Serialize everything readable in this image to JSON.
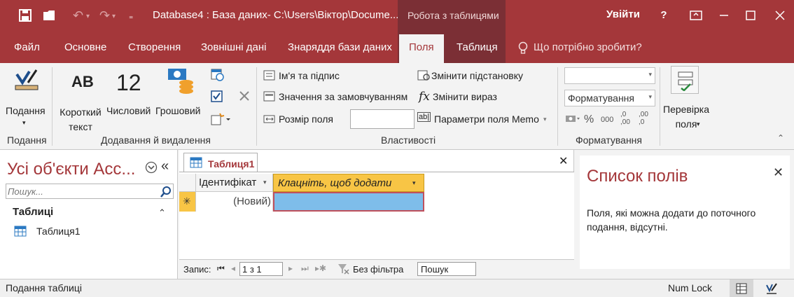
{
  "app": {
    "title": "Database4 : База даних- C:\\Users\\Віктор\\Docume...",
    "context_group": "Робота з таблицями",
    "signin": "Увійти",
    "help": "?"
  },
  "tabs": [
    "Файл",
    "Основне",
    "Створення",
    "Зовнішні дані",
    "Знаряддя бази даних",
    "Поля",
    "Таблиця"
  ],
  "active_tab": "Поля",
  "tell_me": "Що потрібно зробити?",
  "ribbon": {
    "view": {
      "label": "Подання",
      "group": "Подання"
    },
    "add_delete": {
      "short_text": "Короткий\nтекст",
      "short_text_glyph": "AB",
      "number": "Числовий",
      "number_glyph": "12",
      "currency": "Грошовий",
      "group": "Додавання й видалення"
    },
    "properties": {
      "name_caption": "Ім'я та підпис",
      "default_value": "Значення за замовчуванням",
      "field_size": "Розмір поля",
      "modify_lookups": "Змінити підстановку",
      "modify_expression": "Змінити вираз",
      "memo_settings": "Параметри поля Memo",
      "group": "Властивості"
    },
    "formatting": {
      "data_type_value": "",
      "format_value": "Форматування",
      "percent": "%",
      "thousands": "000",
      "inc_dec": ",0\n,00",
      "dec_dec": ",00\n,0",
      "group": "Форматування"
    },
    "validation": {
      "label": "Перевірка\nполя"
    }
  },
  "nav": {
    "title": "Усі об'єкти Acc...",
    "search_placeholder": "Пошук...",
    "group": "Таблиці",
    "items": [
      "Таблиця1"
    ]
  },
  "document": {
    "tab": "Таблиця1",
    "columns": [
      "Ідентифікат",
      "Клацніть, щоб додати"
    ],
    "new_row_value": "(Новий)",
    "new_row_marker": "✳",
    "record_label": "Запис:",
    "record_position": "1 з 1",
    "filter_label": "Без фільтра",
    "search_value": "Пошук"
  },
  "field_list": {
    "title": "Список полів",
    "message": "Поля, які можна додати до поточного подання, відсутні."
  },
  "status": {
    "left": "Подання таблиці",
    "numlock": "Num Lock"
  },
  "colors": {
    "accent": "#a4373a",
    "context": "#7b2f35",
    "add_column_header": "#f8c545",
    "selected_cell": "#7ebdea"
  }
}
